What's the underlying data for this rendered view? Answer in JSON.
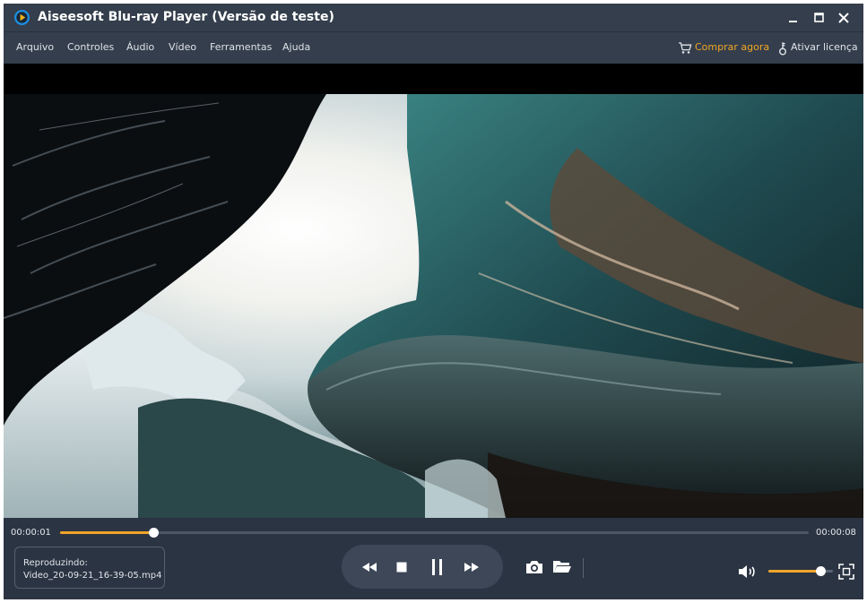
{
  "app": {
    "title": "Aiseesoft Blu-ray Player (Versão de teste)",
    "logo_icon": "play-logo-icon"
  },
  "window_controls": {
    "minimize_icon": "minimize-icon",
    "maximize_icon": "maximize-icon",
    "close_icon": "close-icon"
  },
  "menu": {
    "items": [
      {
        "label": "Arquivo"
      },
      {
        "label": "Controles"
      },
      {
        "label": "Áudio"
      },
      {
        "label": "Vídeo"
      },
      {
        "label": "Ferramentas"
      },
      {
        "label": "Ajuda"
      }
    ],
    "buy": {
      "label": "Comprar agora",
      "icon": "cart-icon",
      "color": "#f1a624"
    },
    "activate": {
      "label": "Ativar licença",
      "icon": "key-icon"
    }
  },
  "player": {
    "time_current": "00:00:01",
    "time_total": "00:00:08",
    "progress": 0.125,
    "now_playing_label": "Reproduzindo:",
    "file_name": "Video_20-09-21_16-39-05.mp4",
    "volume": 0.8,
    "accent_color": "#f0a52a",
    "video_content": "ice-cave-frame",
    "transport": {
      "rewind_icon": "rewind-icon",
      "stop_icon": "stop-icon",
      "pause_icon": "pause-icon",
      "forward_icon": "fast-forward-icon"
    },
    "tools": {
      "snapshot_icon": "camera-icon",
      "open_icon": "folder-icon",
      "volume_icon": "speaker-icon",
      "fullscreen_icon": "fullscreen-icon"
    }
  }
}
